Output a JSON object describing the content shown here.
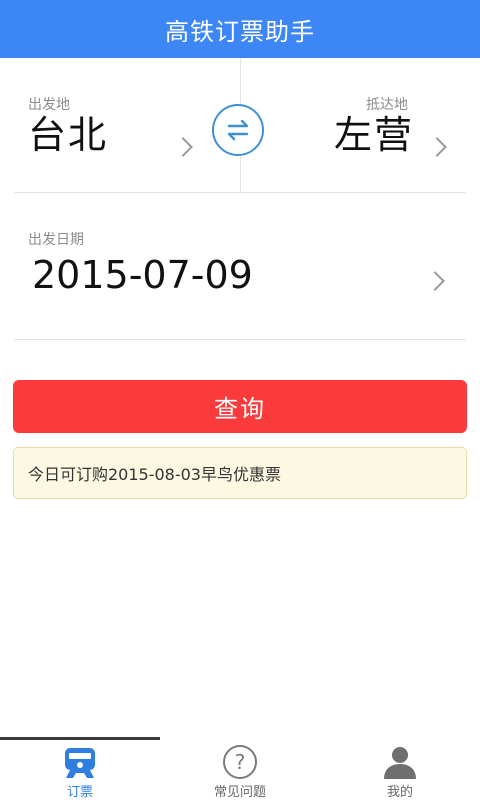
{
  "header": {
    "title": "高铁订票助手"
  },
  "stations": {
    "from_label": "出发地",
    "from_value": "台北",
    "to_label": "抵达地",
    "to_value": "左营"
  },
  "date": {
    "label": "出发日期",
    "value": "2015-07-09"
  },
  "query_button": {
    "label": "查询"
  },
  "notice": {
    "text": "今日可订购2015-08-03早鸟优惠票"
  },
  "tabbar": {
    "tabs": [
      {
        "label": "订票",
        "icon": "train-icon",
        "active": true
      },
      {
        "label": "常见问题",
        "icon": "question-icon",
        "active": false
      },
      {
        "label": "我的",
        "icon": "person-icon",
        "active": false
      }
    ]
  },
  "colors": {
    "header_bg": "#3c87f5",
    "query_bg": "#fb3b3b",
    "notice_bg": "#fcf8e1",
    "active_tab": "#2f7fe0",
    "inactive_tab": "#666666"
  }
}
